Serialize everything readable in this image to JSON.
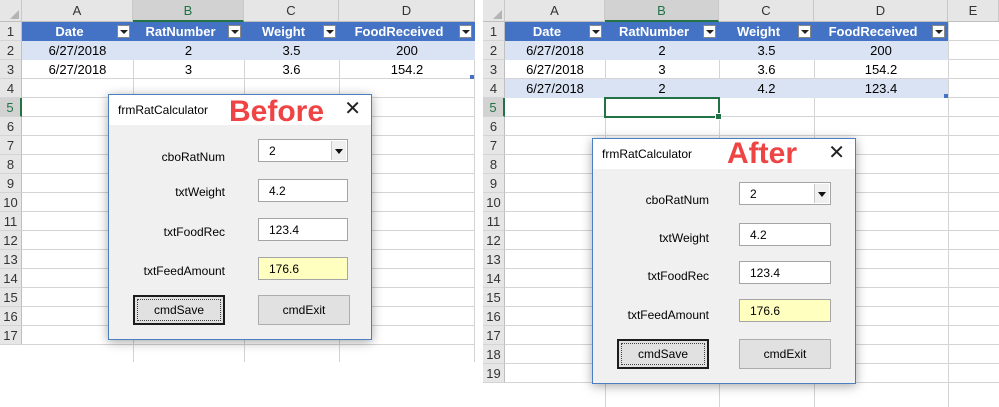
{
  "left_panel": {
    "columns": [
      "A",
      "B",
      "C",
      "D"
    ],
    "selected_column": "B",
    "rows": [
      "1",
      "2",
      "3",
      "4",
      "5",
      "6",
      "7",
      "8",
      "9",
      "10",
      "11",
      "12",
      "13",
      "14",
      "15",
      "16",
      "17"
    ],
    "selected_row": "5",
    "table_headers": [
      "Date",
      "RatNumber",
      "Weight",
      "FoodReceived"
    ],
    "table_rows": [
      [
        "6/27/2018",
        "2",
        "3.5",
        "200"
      ],
      [
        "6/27/2018",
        "3",
        "3.6",
        "154.2"
      ]
    ],
    "dialog": {
      "title": "frmRatCalculator",
      "caption": "Before",
      "close_glyph": "✕",
      "labels": {
        "rat": "cboRatNum",
        "weight": "txtWeight",
        "food": "txtFoodRec",
        "feed": "txtFeedAmount"
      },
      "values": {
        "rat": "2",
        "weight": "4.2",
        "food": "123.4",
        "feed": "176.6"
      },
      "buttons": {
        "save": "cmdSave",
        "exit": "cmdExit"
      }
    }
  },
  "right_panel": {
    "columns": [
      "A",
      "B",
      "C",
      "D",
      "E"
    ],
    "selected_column": "B",
    "rows": [
      "1",
      "2",
      "3",
      "4",
      "5",
      "6",
      "7",
      "8",
      "9",
      "10",
      "11",
      "12",
      "13",
      "14",
      "15",
      "16",
      "17",
      "18",
      "19"
    ],
    "selected_row": "5",
    "table_headers": [
      "Date",
      "RatNumber",
      "Weight",
      "FoodReceived"
    ],
    "table_rows": [
      [
        "6/27/2018",
        "2",
        "3.5",
        "200"
      ],
      [
        "6/27/2018",
        "3",
        "3.6",
        "154.2"
      ],
      [
        "6/27/2018",
        "2",
        "4.2",
        "123.4"
      ]
    ],
    "dialog": {
      "title": "frmRatCalculator",
      "caption": "After",
      "close_glyph": "✕",
      "labels": {
        "rat": "cboRatNum",
        "weight": "txtWeight",
        "food": "txtFoodRec",
        "feed": "txtFeedAmount"
      },
      "values": {
        "rat": "2",
        "weight": "4.2",
        "food": "123.4",
        "feed": "176.6"
      },
      "buttons": {
        "save": "cmdSave",
        "exit": "cmdExit"
      }
    }
  },
  "colors": {
    "table_header": "#4472c4",
    "band_row": "#dae3f3",
    "selection": "#217346",
    "caption": "#ef4444",
    "feed_field": "#ffffc0"
  }
}
